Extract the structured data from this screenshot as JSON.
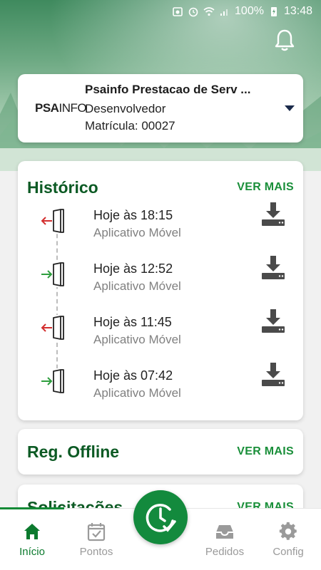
{
  "status_bar": {
    "battery": "100%",
    "time": "13:48"
  },
  "company": {
    "logo_text_bold": "PSA",
    "logo_text_light": "INFO",
    "name": "Psainfo Prestacao de Serv ...",
    "role": "Desenvolvedor",
    "registration": "Matrícula: 00027"
  },
  "history": {
    "title": "Histórico",
    "link": "VER MAIS",
    "entries": [
      {
        "time": "Hoje às 18:15",
        "source": "Aplicativo Móvel",
        "direction": "out"
      },
      {
        "time": "Hoje às 12:52",
        "source": "Aplicativo Móvel",
        "direction": "in"
      },
      {
        "time": "Hoje às 11:45",
        "source": "Aplicativo Móvel",
        "direction": "out"
      },
      {
        "time": "Hoje às 07:42",
        "source": "Aplicativo Móvel",
        "direction": "in"
      }
    ]
  },
  "offline": {
    "title": "Reg. Offline",
    "link": "VER MAIS"
  },
  "requests": {
    "title": "Solicitações",
    "link": "VER MAIS"
  },
  "nav": {
    "items": [
      {
        "label": "Início",
        "icon": "home-icon",
        "active": true
      },
      {
        "label": "Pontos",
        "icon": "calendar-check-icon",
        "active": false
      },
      {
        "label": "Pedidos",
        "icon": "inbox-icon",
        "active": false
      },
      {
        "label": "Config",
        "icon": "gear-icon",
        "active": false
      }
    ],
    "fab_icon": "clock-check-icon"
  },
  "colors": {
    "brand_green": "#0c5a24",
    "link_green": "#1a8f3a",
    "fab_green": "#138a3d",
    "exit_red": "#d32f2f",
    "enter_green": "#2e9e3e"
  }
}
